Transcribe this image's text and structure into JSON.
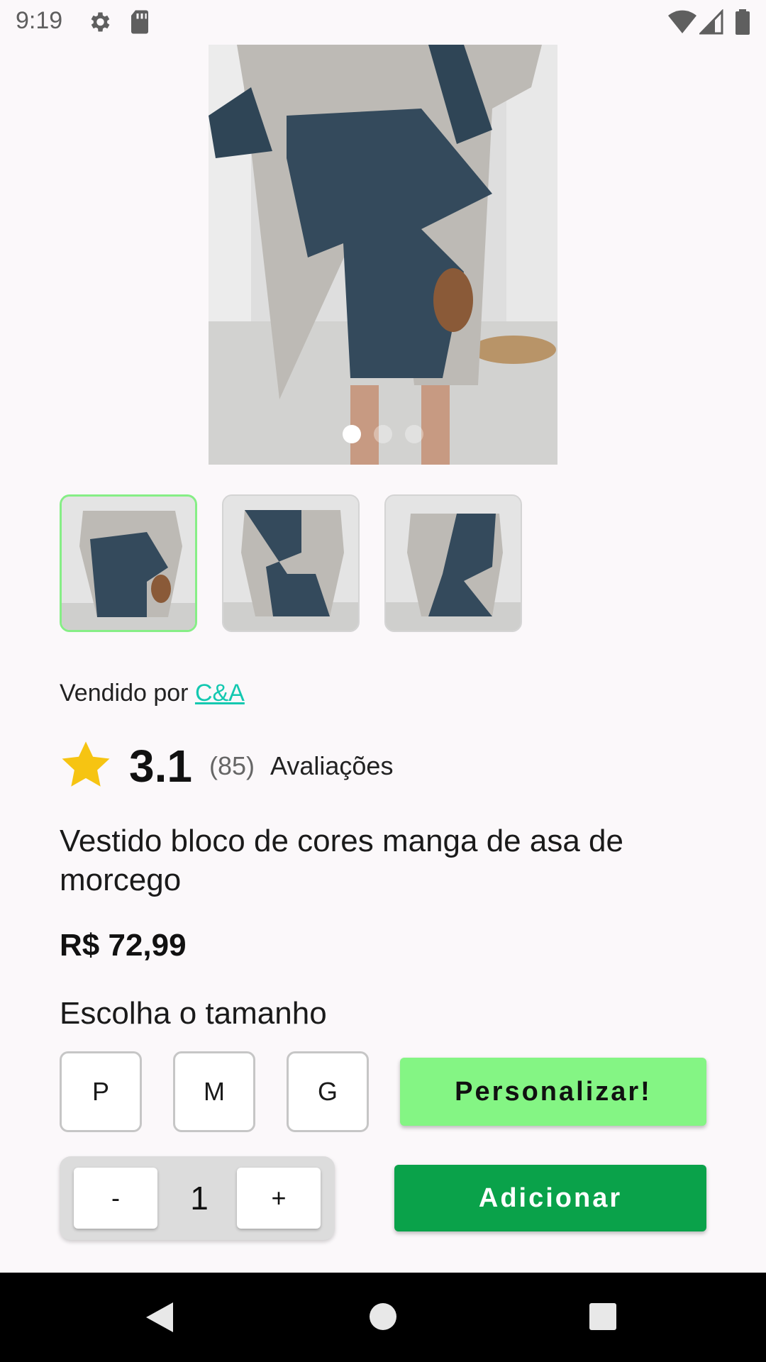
{
  "status_bar": {
    "time": "9:19"
  },
  "product": {
    "sold_by_prefix": "Vendido por",
    "seller": "C&A",
    "rating": "3.1",
    "review_count": "(85)",
    "reviews_label": "Avaliações",
    "title": "Vestido bloco de cores manga de asa de morcego",
    "price": "R$ 72,99",
    "image_count": 3,
    "selected_image": 1
  },
  "sizes": {
    "heading": "Escolha o tamanho",
    "options": [
      "P",
      "M",
      "G"
    ],
    "personalize_label": "Personalizar!"
  },
  "quantity": {
    "decrement_label": "-",
    "value": "1",
    "increment_label": "+"
  },
  "add_button_label": "Adicionar",
  "colors": {
    "seller_link": "#14c8b0",
    "personalize": "#84f584",
    "add_button": "#0aa24a",
    "star": "#f6c412",
    "selected_thumb_border": "#86ee86"
  }
}
